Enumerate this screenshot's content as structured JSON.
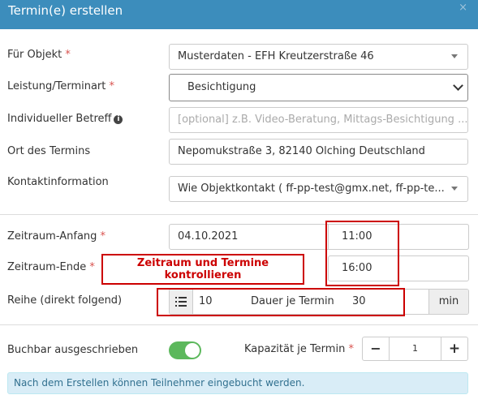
{
  "dialog": {
    "title": "Termin(e) erstellen",
    "close_symbol": "×"
  },
  "form": {
    "objekt": {
      "label": "Für Objekt",
      "required": "*",
      "value": "Musterdaten - EFH Kreutzerstraße 46"
    },
    "leistung": {
      "label": "Leistung/Terminart",
      "required": "*",
      "value": "Besichtigung"
    },
    "betreff": {
      "label": "Individueller Betreff",
      "info_icon": "info-circle-icon",
      "placeholder": "[optional] z.B. Video-Beratung, Mittags-Besichtigung ..."
    },
    "ort": {
      "label": "Ort des Termins",
      "value": "Nepomukstraße 3, 82140 Olching Deutschland"
    },
    "kontakt": {
      "label": "Kontaktinformation",
      "value": "Wie Objektkontakt ( ff-pp-test@gmx.net, ff-pp-te..."
    },
    "anfang": {
      "label": "Zeitraum-Anfang",
      "required": "*",
      "date": "04.10.2021",
      "time": "11:00"
    },
    "ende": {
      "label": "Zeitraum-Ende",
      "required": "*",
      "time": "16:00"
    },
    "reihe": {
      "label": "Reihe (direkt folgend)",
      "list_icon": "list-icon",
      "count": "10",
      "dauer_label": "Dauer je Termin",
      "dauer": "30",
      "unit": "min"
    },
    "buchbar": {
      "label": "Buchbar ausgeschrieben",
      "enabled": true
    },
    "kapazitaet": {
      "label": "Kapazität je Termin",
      "required": "*",
      "minus": "−",
      "value": "1",
      "plus": "+"
    }
  },
  "annotation": {
    "line1": "Zeitraum und Termine",
    "line2": "kontrollieren",
    "color": "#cc0000"
  },
  "notice": "Nach dem Erstellen können Teilnehmer eingebucht werden.",
  "colors": {
    "header": "#3c8dbc",
    "toggle": "#5cb85c",
    "notice_bg": "#d9edf7"
  }
}
